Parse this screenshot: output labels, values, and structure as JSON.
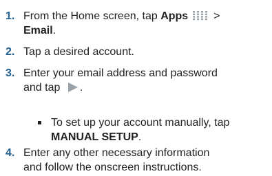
{
  "steps": [
    {
      "number": "1.",
      "text_before": "From the Home screen, tap ",
      "bold_1": "Apps",
      "icon": "apps-grid-icon",
      "text_middle": " >",
      "bold_2": "Email",
      "text_after": "."
    },
    {
      "number": "2.",
      "text": "Tap a desired account."
    },
    {
      "number": "3.",
      "line1": "Enter your email address and password",
      "line2_before": "and tap ",
      "icon": "next-arrow-icon",
      "line2_after": "."
    },
    {
      "number": "4.",
      "line1": "Enter any other necessary information",
      "line2": "and follow the onscreen instructions."
    }
  ],
  "sub_bullet": {
    "line1": "To set up your account manually, tap",
    "bold": "MANUAL SETUP",
    "after": "."
  },
  "colors": {
    "step_number": "#1f5f92",
    "text": "#222222",
    "icon_gray": "#9aa3aa"
  }
}
